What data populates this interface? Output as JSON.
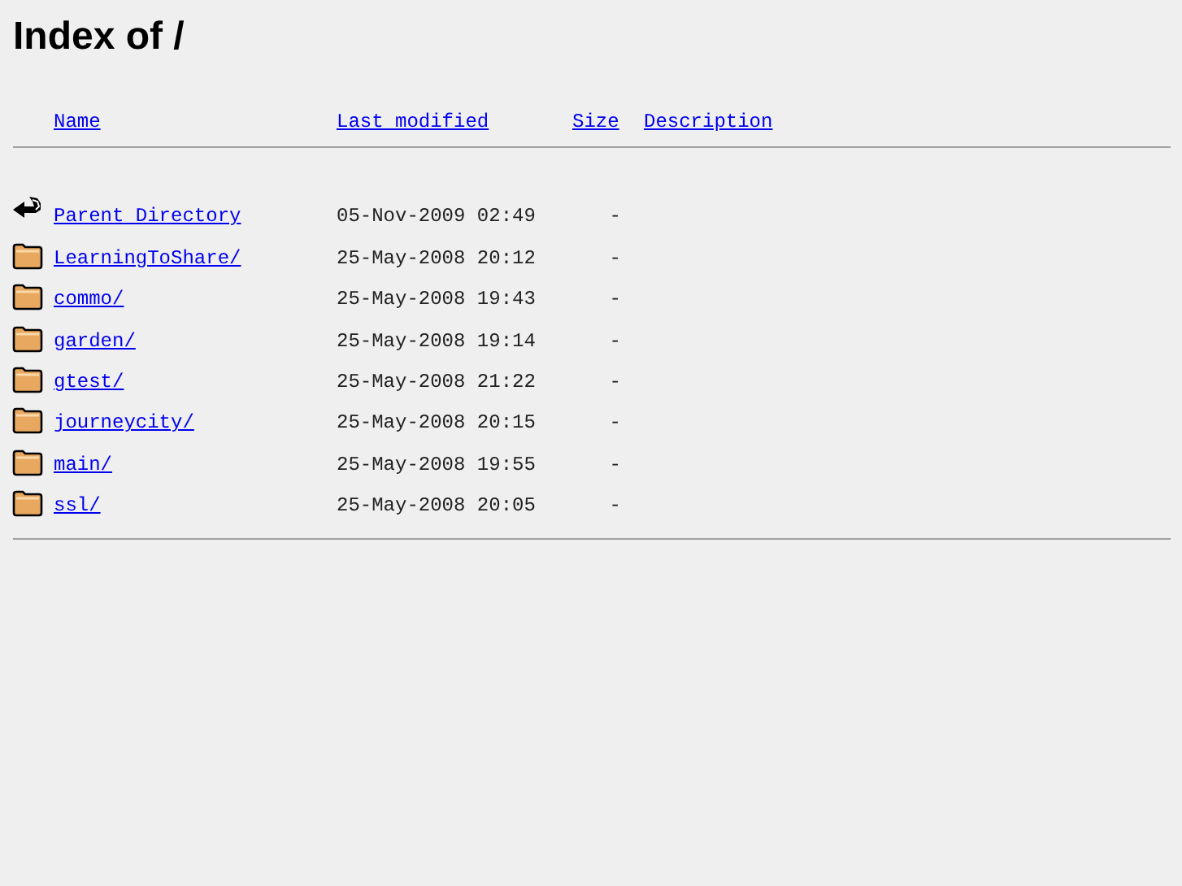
{
  "title": "Index of /",
  "columns": [
    "Name",
    "Last modified",
    "Size",
    "Description"
  ],
  "rows": [
    {
      "kind": "parent",
      "name": "Parent Directory",
      "modified": "05-Nov-2009 02:49",
      "size": "-"
    },
    {
      "kind": "folder",
      "name": "LearningToShare/",
      "modified": "25-May-2008 20:12",
      "size": "-"
    },
    {
      "kind": "folder",
      "name": "commo/",
      "modified": "25-May-2008 19:43",
      "size": "-"
    },
    {
      "kind": "folder",
      "name": "garden/",
      "modified": "25-May-2008 19:14",
      "size": "-"
    },
    {
      "kind": "folder",
      "name": "gtest/",
      "modified": "25-May-2008 21:22",
      "size": "-"
    },
    {
      "kind": "folder",
      "name": "journeycity/",
      "modified": "25-May-2008 20:15",
      "size": "-"
    },
    {
      "kind": "folder",
      "name": "main/",
      "modified": "25-May-2008 19:55",
      "size": "-"
    },
    {
      "kind": "folder",
      "name": "ssl/",
      "modified": "25-May-2008 20:05",
      "size": "-"
    }
  ]
}
